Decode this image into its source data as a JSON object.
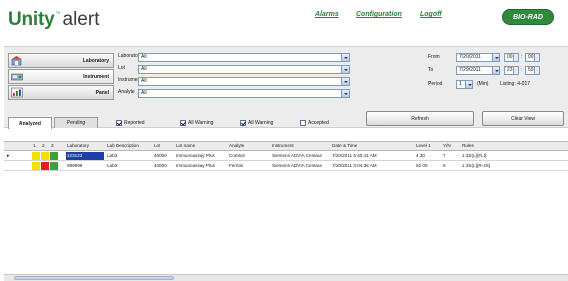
{
  "header": {
    "logo_main": "Unity",
    "logo_tm": "™",
    "logo_sub": "alert",
    "nav": [
      "Alarms",
      "Configuration",
      "Logoff"
    ],
    "brand": "BIO-RAD"
  },
  "nav_buttons": [
    {
      "label": "Laboratory",
      "icon": "laboratory-icon"
    },
    {
      "label": "Instrument",
      "icon": "instrument-icon"
    },
    {
      "label": "Panel",
      "icon": "panel-icon"
    }
  ],
  "filters": [
    {
      "label": "Laboratory",
      "value": "All"
    },
    {
      "label": "Lot",
      "value": "All"
    },
    {
      "label": "Instrument",
      "value": "All"
    },
    {
      "label": "Analyte",
      "value": "All"
    }
  ],
  "tabs": [
    "Analyzed",
    "Pending"
  ],
  "checkboxes": [
    {
      "label": "Reported",
      "checked": true
    },
    {
      "label": "All Warning",
      "checked": true
    },
    {
      "label": "All Warning",
      "checked": true
    },
    {
      "label": "Accepted",
      "checked": false
    }
  ],
  "date_range": {
    "from_label": "From",
    "from_date": "7/20/2011",
    "from_hour": "00",
    "from_min": "00",
    "to_label": "To",
    "to_date": "7/29/2011",
    "to_hour": "23",
    "to_min": "59",
    "period_label": "Period",
    "period_value": "1",
    "period_unit": "(Min)",
    "listing": "Listing: 4-017"
  },
  "buttons": {
    "refresh": "Refresh",
    "clear_view": "Clear View"
  },
  "grid": {
    "columns": [
      "1",
      "2",
      "3",
      "Laboratory",
      "Lab Description",
      "Lot",
      "Lot name",
      "Analyte",
      "Instrument",
      "Date & Time",
      "Level 1",
      "Y/N",
      "Rules"
    ],
    "rows": [
      {
        "laboratory": "123123",
        "description": "Lab3",
        "lot": "40000",
        "lot_name": "Immunoassay Plus",
        "analyte": "Cortisol",
        "instrument": "Siemens ADVIA Centaur",
        "datetime": "7/20/2011 5:40:41 AM",
        "level": "4.30",
        "yn": "7",
        "rules": "1:3S(L)[FLt]"
      },
      {
        "laboratory": "999999",
        "description": "Lab3",
        "lot": "40000",
        "lot_name": "Immunoassay Plus",
        "analyte": "Ferritin",
        "instrument": "Siemens ADVIA Centaur",
        "datetime": "7/20/2011 3:04:38 AM",
        "level": "62.00",
        "yn": "6",
        "rules": "1:3S(L)[R-4S]"
      }
    ]
  },
  "colors": {
    "brand_green": "#2f7f3a",
    "selection_blue": "#1f3fa8",
    "flag_yellow": "#f2e200",
    "flag_red": "#e02020"
  }
}
